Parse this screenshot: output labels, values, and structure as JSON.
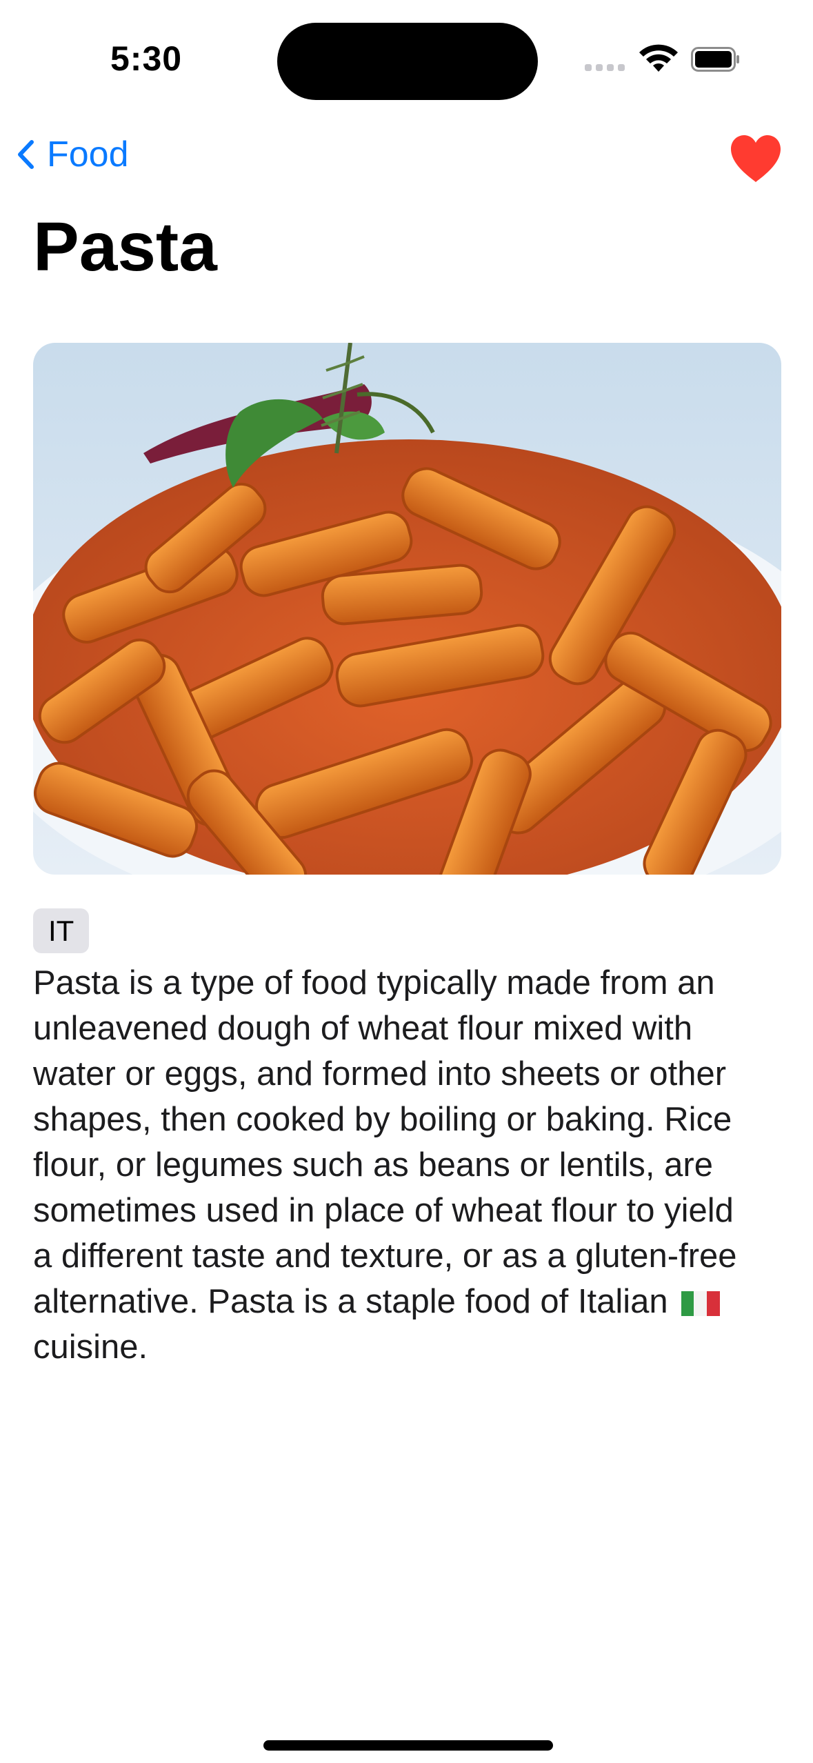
{
  "status": {
    "time": "5:30"
  },
  "nav": {
    "back_label": "Food",
    "favorite_color": "#ff3b30"
  },
  "title": "Pasta",
  "tag": "IT",
  "description": "Pasta is a type of food typically made from an\nunleavened dough of wheat flour mixed with\nwater or eggs, and formed into sheets or other\nshapes, then cooked by boiling or baking. Rice\nflour, or legumes such as beans or lentils, are\nsometimes used in place of wheat flour to yield\na different taste and texture, or as a gluten-free\nalternative. Pasta is a staple food of Italian",
  "description_tail": "cuisine.",
  "colors": {
    "accent": "#0a7aff",
    "heart": "#ff3b30",
    "tag_bg": "#e3e3e8"
  }
}
